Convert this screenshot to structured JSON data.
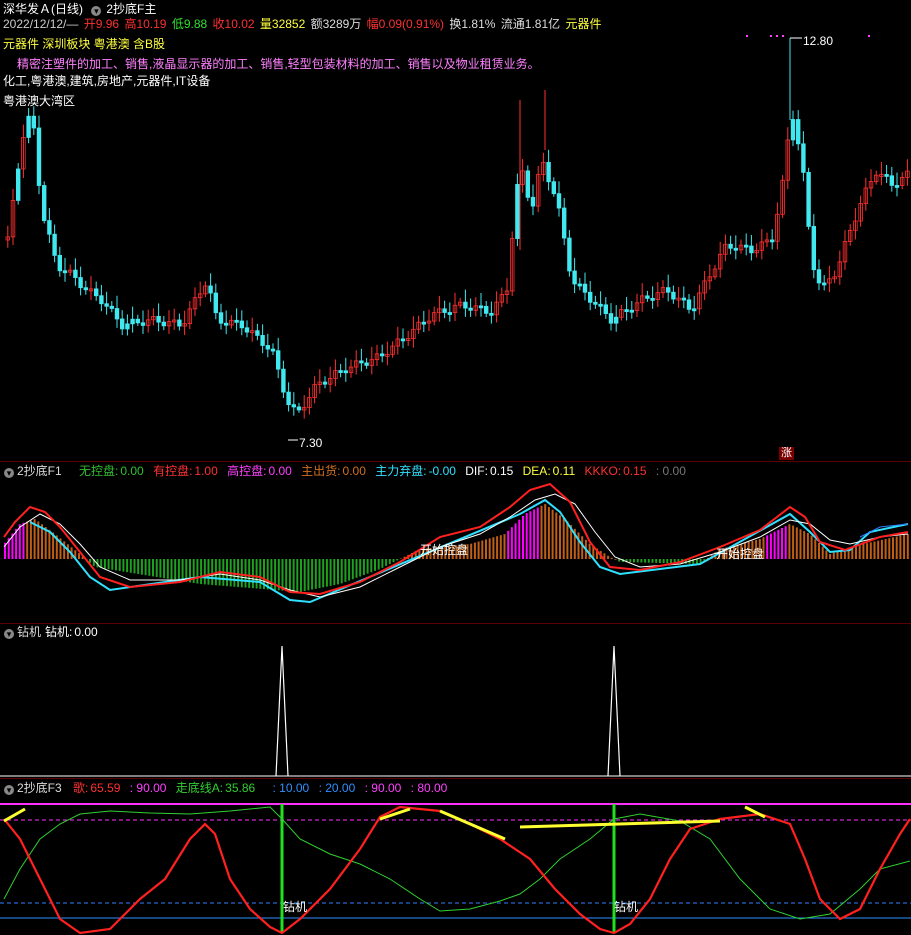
{
  "header": {
    "stock_name": "深华发Ａ",
    "period": "(日线)",
    "indicator_name": "2抄底F主",
    "date": "2022/12/12/—",
    "open": "开9.96",
    "high": "高10.19",
    "low": "低9.88",
    "close": "收10.02",
    "volume": "量32852",
    "amount": "额3289万",
    "change": "幅0.09(0.91%)",
    "turnover": "换1.81%",
    "float_cap": "流通1.81亿",
    "industry": "元器件"
  },
  "info": {
    "tags": "元器件 深圳板块 粤港澳 含B股",
    "business": "精密注塑件的加工、销售,液晶显示器的加工、销售,轻型包装材料的加工、销售以及物业租赁业务。",
    "concepts": "化工,粤港澳,建筑,房地产,元器件,IT设备",
    "region": "粤港澳大湾区"
  },
  "main_chart": {
    "high_label": "12.80",
    "low_label": "7.30",
    "limit_up_badge": "涨"
  },
  "panel_f1": {
    "name": "2抄底F1",
    "wukong_label": "无控盘:",
    "wukong_value": "0.00",
    "youkong_label": "有控盘:",
    "youkong_value": "1.00",
    "gaokong_label": "高控盘:",
    "gaokong_value": "0.00",
    "zhuchu_label": "主出货:",
    "zhuchu_value": "0.00",
    "qipan_label": "主力弃盘:",
    "qipan_value": "-0.00",
    "dif_label": "DIF:",
    "dif_value": "0.15",
    "dea_label": "DEA:",
    "dea_value": "0.11",
    "kkko_label": "KKKO:",
    "kkko_value": "0.15",
    "extra_value": ": 0.00",
    "annotation": "开始控盘",
    "colors": {
      "dif": "#ff2020",
      "dea": "#ffffff",
      "magenta": "#ff00ff",
      "brown": "#c06018",
      "green": "#20a020",
      "cyan": "#30e0ff"
    }
  },
  "panel_drill": {
    "name": "钻机",
    "value_label": "钻机:",
    "value": "0.00"
  },
  "panel_f3": {
    "name": "2抄底F3",
    "ge_label": "歌:",
    "ge_value": "65.59",
    "v90_a": ": 90.00",
    "zoudi_label": "走底线A:",
    "zoudi_value": "35.86",
    "v10": ": 10.00",
    "v20": ": 20.00",
    "v90_b": ": 90.00",
    "v80": ": 80.00",
    "annotation": "钻机"
  }
}
